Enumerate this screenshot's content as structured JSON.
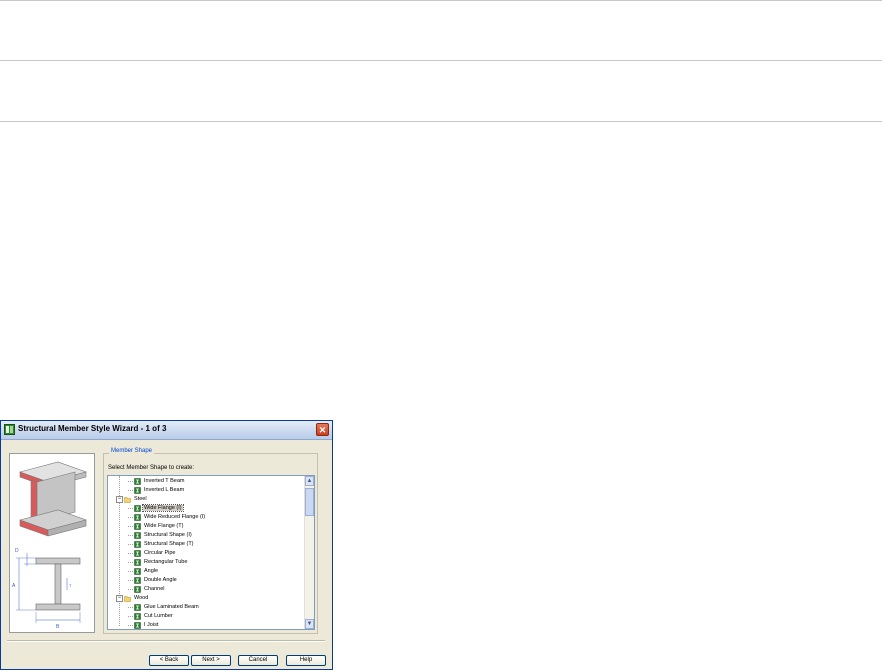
{
  "dialog": {
    "title": "Structural Member Style Wizard - 1 of 3",
    "close_symbol": "✕",
    "group_label": "Member Shape",
    "prompt": "Select Member Shape to create:",
    "tree": [
      {
        "label": "Inverted T Beam",
        "level": 2,
        "icon": "shape-icon"
      },
      {
        "label": "Inverted L Beam",
        "level": 2,
        "icon": "shape-icon"
      },
      {
        "label": "Steel",
        "level": 1,
        "icon": "folder-icon",
        "expanded": true
      },
      {
        "label": "Wide Flange (I)",
        "level": 2,
        "icon": "shape-icon",
        "selected": true
      },
      {
        "label": "Wide Reduced Flange (I)",
        "level": 2,
        "icon": "shape-icon"
      },
      {
        "label": "Wide Flange (T)",
        "level": 2,
        "icon": "shape-icon"
      },
      {
        "label": "Structural Shape (I)",
        "level": 2,
        "icon": "shape-icon"
      },
      {
        "label": "Structural Shape (T)",
        "level": 2,
        "icon": "shape-icon"
      },
      {
        "label": "Circular Pipe",
        "level": 2,
        "icon": "shape-icon"
      },
      {
        "label": "Rectangular Tube",
        "level": 2,
        "icon": "shape-icon"
      },
      {
        "label": "Angle",
        "level": 2,
        "icon": "shape-icon"
      },
      {
        "label": "Double Angle",
        "level": 2,
        "icon": "shape-icon"
      },
      {
        "label": "Channel",
        "level": 2,
        "icon": "shape-icon"
      },
      {
        "label": "Wood",
        "level": 1,
        "icon": "folder-icon",
        "expanded": true
      },
      {
        "label": "Glue Laminated Beam",
        "level": 2,
        "icon": "shape-icon"
      },
      {
        "label": "Cut Lumber",
        "level": 2,
        "icon": "shape-icon"
      },
      {
        "label": "I Joist",
        "level": 2,
        "icon": "shape-icon"
      }
    ],
    "diagram_labels": {
      "d": "D",
      "a": "A",
      "b": "B",
      "t": "T"
    },
    "buttons": {
      "back": "< Back",
      "next": "Next >",
      "cancel": "Cancel",
      "help": "Help"
    },
    "colors": {
      "flange_fill": "#d95a5a",
      "steel_gray": "#c8c8c8",
      "dimension_blue": "#3a5bd0",
      "selection": "#d4d0c8"
    }
  }
}
